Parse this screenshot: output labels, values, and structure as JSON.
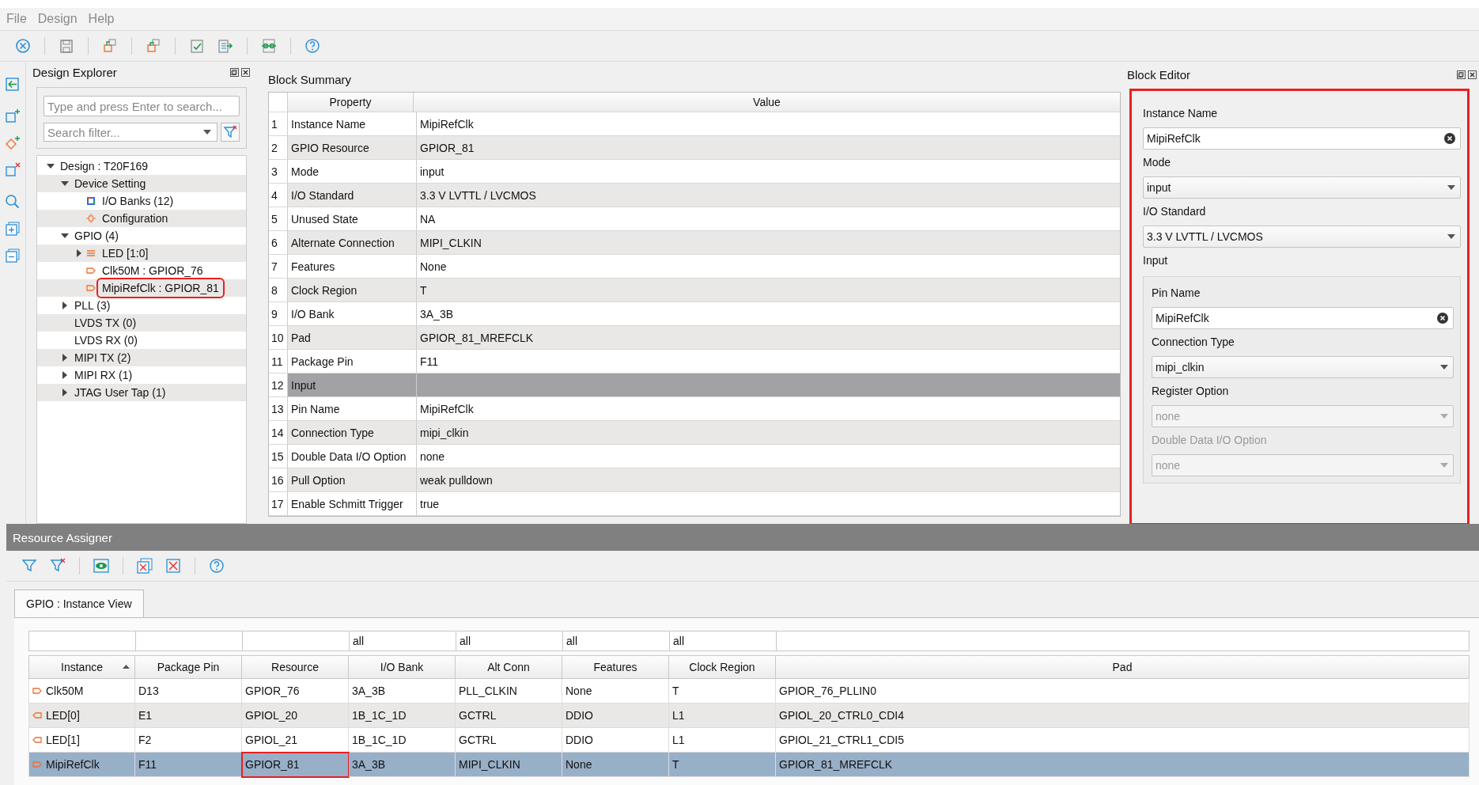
{
  "menu": [
    "File",
    "Design",
    "Help"
  ],
  "design_explorer": {
    "title": "Design Explorer",
    "search": {
      "placeholder": "Type and press Enter to search..."
    },
    "filter": {
      "placeholder": "Search filter..."
    },
    "tree": [
      {
        "label": "Design : T20F169",
        "expanded": true,
        "children": [
          {
            "label": "Device Setting",
            "expanded": true,
            "children": [
              {
                "label": "I/O Banks (12)",
                "kind": "bank"
              },
              {
                "label": "Configuration",
                "kind": "config"
              }
            ]
          },
          {
            "label": "GPIO (4)",
            "expanded": true,
            "children": [
              {
                "label": "LED [1:0]",
                "kind": "bus",
                "expanded": false
              },
              {
                "label": "Clk50M : GPIOR_76",
                "kind": "input"
              },
              {
                "label": "MipiRefClk : GPIOR_81",
                "kind": "input",
                "marked": true
              }
            ]
          },
          {
            "label": "PLL (3)",
            "expanded": false
          },
          {
            "label": "LVDS TX (0)"
          },
          {
            "label": "LVDS RX (0)"
          },
          {
            "label": "MIPI TX (2)",
            "expanded": false
          },
          {
            "label": "MIPI RX (1)",
            "expanded": false
          },
          {
            "label": "JTAG User Tap (1)",
            "expanded": false
          }
        ]
      }
    ]
  },
  "block_summary": {
    "title": "Block Summary",
    "columns": [
      "Property",
      "Value"
    ],
    "rows": [
      {
        "number": "1",
        "property": "Instance Name",
        "value": "MipiRefClk",
        "kind": "field"
      },
      {
        "number": "2",
        "property": "GPIO Resource",
        "value": "GPIOR_81",
        "kind": "field"
      },
      {
        "number": "3",
        "property": "Mode",
        "value": "input",
        "kind": "field"
      },
      {
        "number": "4",
        "property": "I/O Standard",
        "value": "3.3 V LVTTL / LVCMOS",
        "kind": "field"
      },
      {
        "number": "5",
        "property": "Unused State",
        "value": "NA",
        "kind": "field"
      },
      {
        "number": "6",
        "property": "Alternate Connection",
        "value": "MIPI_CLKIN",
        "kind": "field"
      },
      {
        "number": "7",
        "property": "Features",
        "value": "None",
        "kind": "field"
      },
      {
        "number": "8",
        "property": "Clock Region",
        "value": "T",
        "kind": "field"
      },
      {
        "number": "9",
        "property": "I/O Bank",
        "value": "3A_3B",
        "kind": "field"
      },
      {
        "number": "10",
        "property": "Pad",
        "value": "GPIOR_81_MREFCLK",
        "kind": "field"
      },
      {
        "number": "11",
        "property": "Package Pin",
        "value": "F11",
        "kind": "field"
      },
      {
        "number": "12",
        "property": "Input",
        "kind": "section"
      },
      {
        "number": "13",
        "property": "Pin Name",
        "value": "MipiRefClk",
        "kind": "field"
      },
      {
        "number": "14",
        "property": "Connection Type",
        "value": "mipi_clkin",
        "kind": "field"
      },
      {
        "number": "15",
        "property": "Double Data I/O Option",
        "value": "none",
        "kind": "field"
      },
      {
        "number": "16",
        "property": "Pull Option",
        "value": "weak pulldown",
        "kind": "field"
      },
      {
        "number": "17",
        "property": "Enable Schmitt Trigger",
        "value": "true",
        "kind": "field"
      }
    ]
  },
  "block_editor": {
    "title": "Block Editor",
    "marked": true,
    "fields": [
      {
        "label": "Instance Name",
        "kind": "text",
        "value": "MipiRefClk",
        "disabled": false
      },
      {
        "label": "Mode",
        "kind": "select",
        "value": "input",
        "disabled": false
      },
      {
        "label": "I/O Standard",
        "kind": "select",
        "value": "3.3 V LVTTL / LVCMOS",
        "disabled": false
      }
    ],
    "group": {
      "label": "Input",
      "fields": [
        {
          "label": "Pin Name",
          "kind": "text",
          "value": "MipiRefClk",
          "disabled": false,
          "label_greyed": false
        },
        {
          "label": "Connection Type",
          "kind": "select",
          "value": "mipi_clkin",
          "disabled": false,
          "label_greyed": false
        },
        {
          "label": "Register Option",
          "kind": "select",
          "value": "none",
          "disabled": true,
          "label_greyed": false
        },
        {
          "label": "Double Data I/O Option",
          "kind": "select",
          "value": "none",
          "disabled": true,
          "label_greyed": true
        }
      ]
    }
  },
  "resource_assigner": {
    "title": "Resource Assigner",
    "tab": {
      "label": "GPIO : Instance View",
      "selected": true
    },
    "table": {
      "columns": [
        {
          "label": "Instance",
          "sorted": true
        },
        {
          "label": "Package Pin",
          "sorted": false
        },
        {
          "label": "Resource",
          "sorted": false
        },
        {
          "label": "I/O Bank",
          "sorted": false,
          "filter": "all"
        },
        {
          "label": "Alt Conn",
          "sorted": false,
          "filter": "all"
        },
        {
          "label": "Features",
          "sorted": false,
          "filter": "all"
        },
        {
          "label": "Clock Region",
          "sorted": false,
          "filter": "all"
        },
        {
          "label": "Pad",
          "sorted": false
        }
      ],
      "rows": [
        {
          "kind": "input",
          "cells": [
            "Clk50M",
            "D13",
            "GPIOR_76",
            "3A_3B",
            "PLL_CLKIN",
            "None",
            "T",
            "GPIOR_76_PLLIN0"
          ],
          "selected": false
        },
        {
          "kind": "output",
          "cells": [
            "LED[0]",
            "E1",
            "GPIOL_20",
            "1B_1C_1D",
            "GCTRL",
            "DDIO",
            "L1",
            "GPIOL_20_CTRL0_CDI4"
          ],
          "selected": false
        },
        {
          "kind": "output",
          "cells": [
            "LED[1]",
            "F2",
            "GPIOL_21",
            "1B_1C_1D",
            "GCTRL",
            "DDIO",
            "L1",
            "GPIOL_21_CTRL1_CDI5"
          ],
          "selected": false
        },
        {
          "kind": "input",
          "cells": [
            "MipiRefClk",
            "F11",
            "GPIOR_81",
            "3A_3B",
            "MIPI_CLKIN",
            "None",
            "T",
            "GPIOR_81_MREFCLK"
          ],
          "selected": true,
          "marked": true
        }
      ]
    }
  }
}
